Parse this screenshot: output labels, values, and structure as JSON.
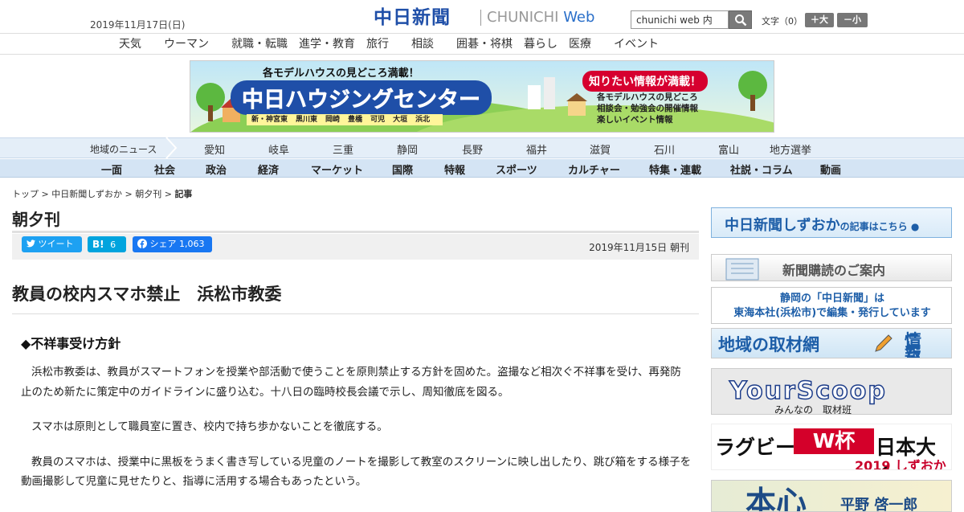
{
  "header": {
    "date": "2019年11月17日(日)",
    "logo_ja": "中日新聞",
    "logo_en_a": "CHUNICHI ",
    "logo_en_b": "Web",
    "search_value": "chunichi web 内",
    "moji_label": "文字（0）",
    "big_label": "＋大",
    "small_label": "－小"
  },
  "subnav": [
    "天気",
    "ウーマン",
    "就職・転職",
    "進学・教育",
    "旅行",
    "相談",
    "囲碁・将棋",
    "暮らし",
    "医療",
    "イベント"
  ],
  "banner": {
    "top_text": "各モデルハウスの見どころ満載！",
    "main_text": "中日ハウジングセンター",
    "badge_text": "知りたい情報が満載！",
    "points": [
      "各モデルハウスの見どころ",
      "相談会・勉強会の開催情報",
      "楽しいイベント情報"
    ],
    "sites": [
      "新・神宮東",
      "黒川東",
      "岡崎",
      "豊橋",
      "可児",
      "大垣",
      "浜北"
    ]
  },
  "region": {
    "label": "地域のニュース",
    "items": [
      "愛知",
      "岐阜",
      "三重",
      "静岡",
      "長野",
      "福井",
      "滋賀",
      "石川",
      "富山",
      "地方選挙"
    ]
  },
  "mainnav": [
    "一面",
    "社会",
    "政治",
    "経済",
    "マーケット",
    "国際",
    "特報",
    "スポーツ",
    "カルチャー",
    "特集・連載",
    "社説・コラム",
    "動画"
  ],
  "breadcrumb": {
    "items": [
      "トップ",
      "中日新聞しずおか",
      "朝夕刊"
    ],
    "sep": " > ",
    "current": "記事"
  },
  "section_title": "朝夕刊",
  "share": {
    "tweet": "ツイート",
    "hatena_count": "6",
    "fb_label": "シェア",
    "fb_count": "1,063"
  },
  "pub_date": "2019年11月15日 朝刊",
  "article": {
    "title": "教員の校内スマホ禁止　浜松市教委",
    "subtitle": "◆不祥事受け方針",
    "paragraphs": [
      "浜松市教委は、教員がスマートフォンを授業や部活動で使うことを原則禁止する方針を固めた。盗撮など相次ぐ不祥事を受け、再発防止のため新たに策定中のガイドラインに盛り込む。十八日の臨時校長会議で示し、周知徹底を図る。",
      "スマホは原則として職員室に置き、校内で持ち歩かないことを徹底する。",
      "教員のスマホは、授業中に黒板をうまく書き写している児童のノートを撮影して教室のスクリーンに映し出したり、跳び箱をする様子を動画撮影して児童に見せたりと、指導に活用する場合もあったという。"
    ]
  },
  "sidebar": {
    "s1_main": "中日新聞しずおか",
    "s1_small": "の記事はこちら ●",
    "s2": "新聞購読のご案内",
    "s3_line1": "静岡の「中日新聞」は",
    "s3_line2": "東海本社(浜松市)で編集・発行しています",
    "s4_main": "地域の取材網",
    "s4_small1": "情報提供は",
    "s4_small2": "こちらへ",
    "s5_main": "YourScoop",
    "s5_small": "みんなの　取材班",
    "s6_a": "ラグビー",
    "s6_b": "W杯",
    "s6_c": "日本大会",
    "s6_d": "2019 しずおか",
    "s7_main": "本心",
    "s7_small": "平野 啓一郎"
  },
  "colors": {
    "brand_blue": "#1f4fa8",
    "twitter": "#1da1f2",
    "hatena": "#00a4de",
    "facebook": "#1877f2",
    "nav_bg": "#d4e4f4"
  }
}
